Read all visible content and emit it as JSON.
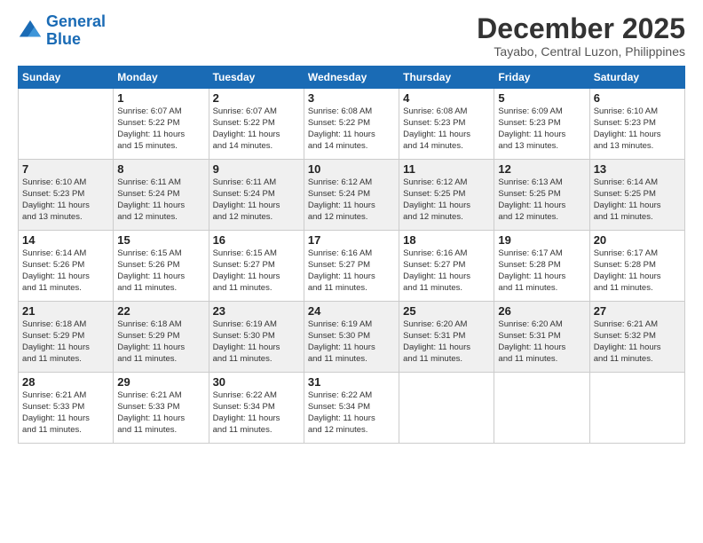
{
  "logo": {
    "line1": "General",
    "line2": "Blue"
  },
  "title": "December 2025",
  "location": "Tayabo, Central Luzon, Philippines",
  "days_header": [
    "Sunday",
    "Monday",
    "Tuesday",
    "Wednesday",
    "Thursday",
    "Friday",
    "Saturday"
  ],
  "weeks": [
    [
      {
        "num": "",
        "info": ""
      },
      {
        "num": "1",
        "info": "Sunrise: 6:07 AM\nSunset: 5:22 PM\nDaylight: 11 hours\nand 15 minutes."
      },
      {
        "num": "2",
        "info": "Sunrise: 6:07 AM\nSunset: 5:22 PM\nDaylight: 11 hours\nand 14 minutes."
      },
      {
        "num": "3",
        "info": "Sunrise: 6:08 AM\nSunset: 5:22 PM\nDaylight: 11 hours\nand 14 minutes."
      },
      {
        "num": "4",
        "info": "Sunrise: 6:08 AM\nSunset: 5:23 PM\nDaylight: 11 hours\nand 14 minutes."
      },
      {
        "num": "5",
        "info": "Sunrise: 6:09 AM\nSunset: 5:23 PM\nDaylight: 11 hours\nand 13 minutes."
      },
      {
        "num": "6",
        "info": "Sunrise: 6:10 AM\nSunset: 5:23 PM\nDaylight: 11 hours\nand 13 minutes."
      }
    ],
    [
      {
        "num": "7",
        "info": "Sunrise: 6:10 AM\nSunset: 5:23 PM\nDaylight: 11 hours\nand 13 minutes."
      },
      {
        "num": "8",
        "info": "Sunrise: 6:11 AM\nSunset: 5:24 PM\nDaylight: 11 hours\nand 12 minutes."
      },
      {
        "num": "9",
        "info": "Sunrise: 6:11 AM\nSunset: 5:24 PM\nDaylight: 11 hours\nand 12 minutes."
      },
      {
        "num": "10",
        "info": "Sunrise: 6:12 AM\nSunset: 5:24 PM\nDaylight: 11 hours\nand 12 minutes."
      },
      {
        "num": "11",
        "info": "Sunrise: 6:12 AM\nSunset: 5:25 PM\nDaylight: 11 hours\nand 12 minutes."
      },
      {
        "num": "12",
        "info": "Sunrise: 6:13 AM\nSunset: 5:25 PM\nDaylight: 11 hours\nand 12 minutes."
      },
      {
        "num": "13",
        "info": "Sunrise: 6:14 AM\nSunset: 5:25 PM\nDaylight: 11 hours\nand 11 minutes."
      }
    ],
    [
      {
        "num": "14",
        "info": "Sunrise: 6:14 AM\nSunset: 5:26 PM\nDaylight: 11 hours\nand 11 minutes."
      },
      {
        "num": "15",
        "info": "Sunrise: 6:15 AM\nSunset: 5:26 PM\nDaylight: 11 hours\nand 11 minutes."
      },
      {
        "num": "16",
        "info": "Sunrise: 6:15 AM\nSunset: 5:27 PM\nDaylight: 11 hours\nand 11 minutes."
      },
      {
        "num": "17",
        "info": "Sunrise: 6:16 AM\nSunset: 5:27 PM\nDaylight: 11 hours\nand 11 minutes."
      },
      {
        "num": "18",
        "info": "Sunrise: 6:16 AM\nSunset: 5:27 PM\nDaylight: 11 hours\nand 11 minutes."
      },
      {
        "num": "19",
        "info": "Sunrise: 6:17 AM\nSunset: 5:28 PM\nDaylight: 11 hours\nand 11 minutes."
      },
      {
        "num": "20",
        "info": "Sunrise: 6:17 AM\nSunset: 5:28 PM\nDaylight: 11 hours\nand 11 minutes."
      }
    ],
    [
      {
        "num": "21",
        "info": "Sunrise: 6:18 AM\nSunset: 5:29 PM\nDaylight: 11 hours\nand 11 minutes."
      },
      {
        "num": "22",
        "info": "Sunrise: 6:18 AM\nSunset: 5:29 PM\nDaylight: 11 hours\nand 11 minutes."
      },
      {
        "num": "23",
        "info": "Sunrise: 6:19 AM\nSunset: 5:30 PM\nDaylight: 11 hours\nand 11 minutes."
      },
      {
        "num": "24",
        "info": "Sunrise: 6:19 AM\nSunset: 5:30 PM\nDaylight: 11 hours\nand 11 minutes."
      },
      {
        "num": "25",
        "info": "Sunrise: 6:20 AM\nSunset: 5:31 PM\nDaylight: 11 hours\nand 11 minutes."
      },
      {
        "num": "26",
        "info": "Sunrise: 6:20 AM\nSunset: 5:31 PM\nDaylight: 11 hours\nand 11 minutes."
      },
      {
        "num": "27",
        "info": "Sunrise: 6:21 AM\nSunset: 5:32 PM\nDaylight: 11 hours\nand 11 minutes."
      }
    ],
    [
      {
        "num": "28",
        "info": "Sunrise: 6:21 AM\nSunset: 5:33 PM\nDaylight: 11 hours\nand 11 minutes."
      },
      {
        "num": "29",
        "info": "Sunrise: 6:21 AM\nSunset: 5:33 PM\nDaylight: 11 hours\nand 11 minutes."
      },
      {
        "num": "30",
        "info": "Sunrise: 6:22 AM\nSunset: 5:34 PM\nDaylight: 11 hours\nand 11 minutes."
      },
      {
        "num": "31",
        "info": "Sunrise: 6:22 AM\nSunset: 5:34 PM\nDaylight: 11 hours\nand 12 minutes."
      },
      {
        "num": "",
        "info": ""
      },
      {
        "num": "",
        "info": ""
      },
      {
        "num": "",
        "info": ""
      }
    ]
  ]
}
